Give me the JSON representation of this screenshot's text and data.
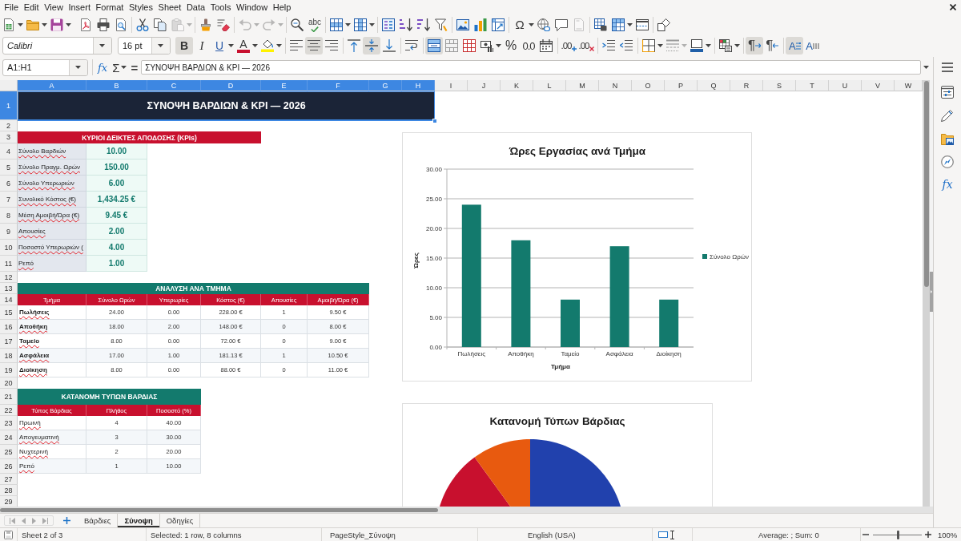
{
  "menu_bar": {
    "items": [
      "File",
      "Edit",
      "View",
      "Insert",
      "Format",
      "Styles",
      "Sheet",
      "Data",
      "Tools",
      "Window",
      "Help"
    ]
  },
  "standard_toolbar": {
    "paste": {
      "disabled": true
    },
    "undo": {
      "disabled": true
    },
    "redo": {
      "disabled": true
    },
    "header_footer": {
      "disabled": true
    },
    "spelling": {
      "glyph": "abc"
    },
    "special_character": {
      "glyph": "Ω"
    }
  },
  "formatting_toolbar": {
    "font_name": "Calibri",
    "font_size": "16 pt",
    "bold": {
      "glyph": "B",
      "on": true
    },
    "italic": {
      "glyph": "I",
      "on": false
    },
    "underline": {
      "glyph": "U",
      "on": false
    },
    "font_color": {
      "glyph": "A"
    },
    "align_left": {
      "on": false
    },
    "align_center": {
      "on": true
    },
    "align_right": {
      "on": false
    },
    "align_top": {
      "on": false
    },
    "align_middle": {
      "on": true
    },
    "align_bottom": {
      "on": false
    },
    "merge_and_center": {
      "on": true
    },
    "percent": {
      "glyph": "%"
    },
    "number": {
      "glyph": "0.0"
    },
    "add_decimal": {
      "glyph": ".00"
    },
    "delete_decimal": {
      "glyph": ".00"
    },
    "paragraph_ltr": {
      "glyph": "¶",
      "on": true
    },
    "paragraph_rtl": {
      "glyph": "¶",
      "on": false
    },
    "text_ltr": {
      "glyph": "A",
      "on": true
    },
    "text_ttb": {
      "glyph": "A",
      "on": false
    }
  },
  "formula_bar": {
    "name_box": "A1:H1",
    "function_wizard": "fx",
    "sum": "Σ",
    "formula": "=",
    "value": "ΣΥΝΟΨΗ ΒΑΡΔΙΩΝ & KPI — 2026"
  },
  "sidebar": {
    "functions": "fx"
  },
  "column_headers": [
    {
      "label": "A",
      "selected": true
    },
    {
      "label": "B",
      "selected": true
    },
    {
      "label": "C",
      "selected": true
    },
    {
      "label": "D",
      "selected": true
    },
    {
      "label": "E",
      "selected": true
    },
    {
      "label": "F",
      "selected": true
    },
    {
      "label": "G",
      "selected": true
    },
    {
      "label": "H",
      "selected": true
    },
    {
      "label": "I",
      "selected": false
    },
    {
      "label": "J",
      "selected": false
    },
    {
      "label": "K",
      "selected": false
    },
    {
      "label": "L",
      "selected": false
    },
    {
      "label": "M",
      "selected": false
    },
    {
      "label": "N",
      "selected": false
    },
    {
      "label": "O",
      "selected": false
    },
    {
      "label": "P",
      "selected": false
    },
    {
      "label": "Q",
      "selected": false
    },
    {
      "label": "R",
      "selected": false
    },
    {
      "label": "S",
      "selected": false
    },
    {
      "label": "T",
      "selected": false
    },
    {
      "label": "U",
      "selected": false
    },
    {
      "label": "V",
      "selected": false
    },
    {
      "label": "W",
      "selected": false
    }
  ],
  "row_headers": [
    {
      "label": "1",
      "selected": true
    },
    {
      "label": "2",
      "selected": false
    },
    {
      "label": "3",
      "selected": false
    },
    {
      "label": "4",
      "selected": false
    },
    {
      "label": "5",
      "selected": false
    },
    {
      "label": "6",
      "selected": false
    },
    {
      "label": "7",
      "selected": false
    },
    {
      "label": "8",
      "selected": false
    },
    {
      "label": "9",
      "selected": false
    },
    {
      "label": "10",
      "selected": false
    },
    {
      "label": "11",
      "selected": false
    },
    {
      "label": "12",
      "selected": false
    },
    {
      "label": "13",
      "selected": false
    },
    {
      "label": "14",
      "selected": false
    },
    {
      "label": "15",
      "selected": false
    },
    {
      "label": "16",
      "selected": false
    },
    {
      "label": "17",
      "selected": false
    },
    {
      "label": "18",
      "selected": false
    },
    {
      "label": "19",
      "selected": false
    },
    {
      "label": "20",
      "selected": false
    },
    {
      "label": "21",
      "selected": false
    },
    {
      "label": "22",
      "selected": false
    },
    {
      "label": "23",
      "selected": false
    },
    {
      "label": "24",
      "selected": false
    },
    {
      "label": "25",
      "selected": false
    },
    {
      "label": "26",
      "selected": false
    },
    {
      "label": "27",
      "selected": false
    },
    {
      "label": "28",
      "selected": false
    },
    {
      "label": "29",
      "selected": false
    }
  ],
  "sheet": {
    "title": {
      "text": "ΣΥΝΟΨΗ ΒΑΡΔΙΩΝ & KPI — 2026",
      "selected": true
    },
    "kpi_table": {
      "title": "ΚΥΡΙΟΙ ΔΕΙΚΤΕΣ ΑΠΟΔΟΣΗΣ (KPIs)",
      "rows": [
        {
          "label": "Σύνολο Βαρδιών",
          "value": "10.00"
        },
        {
          "label": "Σύνολο Πραγμ. Ωρών",
          "value": "150.00"
        },
        {
          "label": "Σύνολο Υπερωριών",
          "value": "6.00"
        },
        {
          "label": "Συνολικό Κόστος (€)",
          "value": "1,434.25 €"
        },
        {
          "label": "Μέση Αμοιβή/Ώρα (€)",
          "value": "9.45 €"
        },
        {
          "label": "Απουσίες",
          "value": "2.00"
        },
        {
          "label": "Ποσοστό Υπερωριών (",
          "value": "4.00"
        },
        {
          "label": "Ρεπό",
          "value": "1.00"
        }
      ]
    },
    "department_table": {
      "title": "ΑΝΑΛΥΣΗ ΑΝΑ ΤΜΗΜΑ",
      "columns": [
        "Τμήμα",
        "Σύνολο Ωρών",
        "Υπερωρίες",
        "Κόστος (€)",
        "Απουσίες",
        "Αμοιβή/Ώρα (€)"
      ],
      "rows": [
        [
          "Πωλήσεις",
          "24.00",
          "0.00",
          "228.00 €",
          "1",
          "9.50 €"
        ],
        [
          "Αποθήκη",
          "18.00",
          "2.00",
          "148.00 €",
          "0",
          "8.00 €"
        ],
        [
          "Ταμείο",
          "8.00",
          "0.00",
          "72.00 €",
          "0",
          "9.00 €"
        ],
        [
          "Ασφάλεια",
          "17.00",
          "1.00",
          "181.13 €",
          "1",
          "10.50 €"
        ],
        [
          "Διοίκηση",
          "8.00",
          "0.00",
          "88.00 €",
          "0",
          "11.00 €"
        ]
      ]
    },
    "shift_table": {
      "title": "ΚΑΤΑΝΟΜΗ ΤΥΠΩΝ ΒΑΡΔΙΑΣ",
      "columns": [
        "Τύπος Βάρδιας",
        "Πλήθος",
        "Ποσοστό (%)"
      ],
      "rows": [
        [
          "Πρωινή",
          "4",
          "40.00"
        ],
        [
          "Απογευματινή",
          "3",
          "30.00"
        ],
        [
          "Νυχτερινή",
          "2",
          "20.00"
        ],
        [
          "Ρεπό",
          "1",
          "10.00"
        ]
      ]
    },
    "bar_chart": {
      "chart_data": {
        "type": "bar",
        "title": "Ώρες Εργασίας ανά Τμήμα",
        "xlabel": "Τμήμα",
        "ylabel": "Ώρες",
        "categories": [
          "Πωλήσεις",
          "Αποθήκη",
          "Ταμείο",
          "Ασφάλεια",
          "Διοίκηση"
        ],
        "series": [
          {
            "name": "Σύνολο Ωρών",
            "color": "#137a6d",
            "values": [
              24,
              18,
              8,
              17,
              8
            ]
          }
        ],
        "ylim": [
          0,
          30
        ],
        "yticks": [
          {
            "value": 0,
            "label": "0.00"
          },
          {
            "value": 5,
            "label": "5.00"
          },
          {
            "value": 10,
            "label": "10.00"
          },
          {
            "value": 15,
            "label": "15.00"
          },
          {
            "value": 20,
            "label": "20.00"
          },
          {
            "value": 25,
            "label": "25.00"
          },
          {
            "value": 30,
            "label": "30.00"
          }
        ],
        "grid": true
      }
    },
    "pie_chart": {
      "title": "Κατανομή Τύπων Βάρδιας"
    }
  },
  "sheet_tabs": [
    {
      "label": "Βάρδιες",
      "selected": false
    },
    {
      "label": "Σύνοψη",
      "selected": true
    },
    {
      "label": "Οδηγίες",
      "selected": false
    }
  ],
  "status_bar": {
    "sheet": "Sheet 2 of 3",
    "selection": "Selected: 1 row, 8 columns",
    "page_style": "PageStyle_Σύνοψη",
    "language": "English (USA)",
    "summary": "Average: ; Sum: 0",
    "zoom": {
      "level": 0.5,
      "reading": "100%"
    }
  }
}
